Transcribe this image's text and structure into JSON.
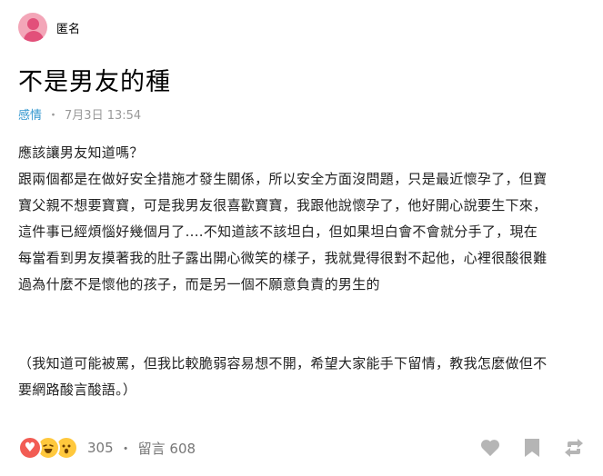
{
  "author": {
    "name": "匿名"
  },
  "post": {
    "title": "不是男友的種",
    "board": "感情",
    "separator": "・",
    "date": "7月3日 13:54",
    "lines": [
      "應該讓男友知道嗎？",
      "跟兩個都是在做好安全措施才發生關係，所以安全方面沒問題，只是最近懷孕了，但寶",
      "寶父親不想要寶寶，可是我男友很喜歡寶寶，我跟他說懷孕了，他好開心說要生下來，",
      "這件事已經煩惱好幾個月了....不知道該不該坦白，但如果坦白會不會就分手了，現在",
      "每當看到男友摸著我的肚子露出開心微笑的樣子，我就覺得很對不起他，心裡很酸很難",
      "過為什麼不是懷他的孩子，而是另一個不願意負責的男生的"
    ],
    "note_lines": [
      "（我知道可能被罵，但我比較脆弱容易想不開，希望大家能手下留情，教我怎麼做但不",
      "要網路酸言酸語。）"
    ]
  },
  "footer": {
    "reactions": [
      "heart-icon",
      "laugh-icon",
      "wow-icon"
    ],
    "reaction_count": "305",
    "separator": "・",
    "comments_label": "留言 608"
  },
  "colors": {
    "board": "#3397cf",
    "meta": "#999999",
    "avatar_bg": "#f3a6b8",
    "avatar_fg": "#e2507a",
    "icon": "#b5b5b5"
  }
}
